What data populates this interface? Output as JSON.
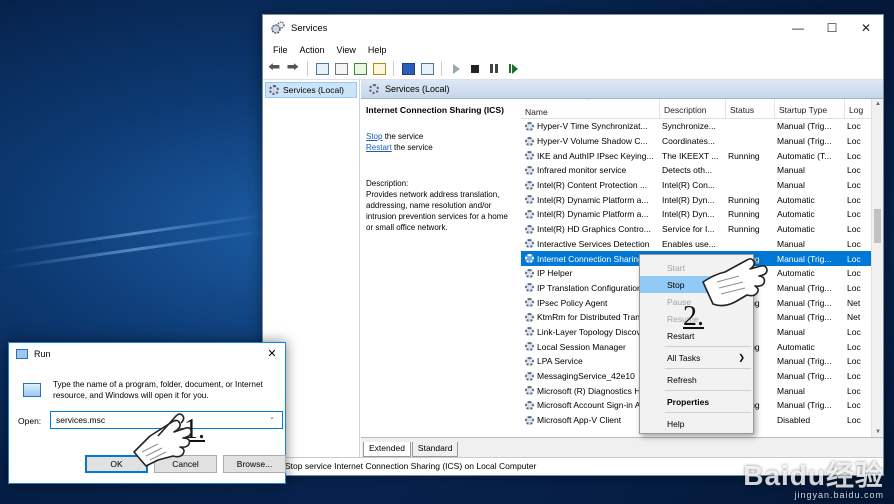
{
  "services_window": {
    "title": "Services",
    "menu": [
      "File",
      "Action",
      "View",
      "Help"
    ],
    "tree_item": "Services (Local)",
    "header": "Services (Local)",
    "detail": {
      "service_name": "Internet Connection Sharing (ICS)",
      "stop_link": "Stop",
      "stop_suffix": " the service",
      "restart_link": "Restart",
      "restart_suffix": " the service",
      "description_label": "Description:",
      "description": "Provides network address translation, addressing, name resolution and/or intrusion prevention services for a home or small office network."
    },
    "columns": [
      "Name",
      "Description",
      "Status",
      "Startup Type",
      "Log"
    ],
    "rows": [
      {
        "name": "Hyper-V Time Synchronizat...",
        "desc": "Synchronize...",
        "status": "",
        "startup": "Manual (Trig...",
        "log": "Loc",
        "selected": false
      },
      {
        "name": "Hyper-V Volume Shadow C...",
        "desc": "Coordinates...",
        "status": "",
        "startup": "Manual (Trig...",
        "log": "Loc",
        "selected": false
      },
      {
        "name": "IKE and AuthIP IPsec Keying...",
        "desc": "The IKEEXT ...",
        "status": "Running",
        "startup": "Automatic (T...",
        "log": "Loc",
        "selected": false
      },
      {
        "name": "Infrared monitor service",
        "desc": "Detects oth...",
        "status": "",
        "startup": "Manual",
        "log": "Loc",
        "selected": false
      },
      {
        "name": "Intel(R) Content Protection ...",
        "desc": "Intel(R) Con...",
        "status": "",
        "startup": "Manual",
        "log": "Loc",
        "selected": false
      },
      {
        "name": "Intel(R) Dynamic Platform a...",
        "desc": "Intel(R) Dyn...",
        "status": "Running",
        "startup": "Automatic",
        "log": "Loc",
        "selected": false
      },
      {
        "name": "Intel(R) Dynamic Platform a...",
        "desc": "Intel(R) Dyn...",
        "status": "Running",
        "startup": "Automatic",
        "log": "Loc",
        "selected": false
      },
      {
        "name": "Intel(R) HD Graphics Contro...",
        "desc": "Service for I...",
        "status": "Running",
        "startup": "Automatic",
        "log": "Loc",
        "selected": false
      },
      {
        "name": "Interactive Services Detection",
        "desc": "Enables use...",
        "status": "",
        "startup": "Manual",
        "log": "Loc",
        "selected": false
      },
      {
        "name": "Internet Connection Sharing (ICS)",
        "desc": "",
        "status": "Running",
        "startup": "Manual (Trig...",
        "log": "Loc",
        "selected": true
      },
      {
        "name": "IP Helper",
        "desc": "",
        "status": "Running",
        "startup": "Automatic",
        "log": "Loc",
        "selected": false
      },
      {
        "name": "IP Translation Configuration Service",
        "desc": "",
        "status": "",
        "startup": "Manual (Trig...",
        "log": "Loc",
        "selected": false
      },
      {
        "name": "IPsec Policy Agent",
        "desc": "",
        "status": "Running",
        "startup": "Manual (Trig...",
        "log": "Net",
        "selected": false
      },
      {
        "name": "KtmRm for Distributed Transaction Coordinator",
        "desc": "",
        "status": "",
        "startup": "Manual (Trig...",
        "log": "Net",
        "selected": false
      },
      {
        "name": "Link-Layer Topology Discovery Mapper",
        "desc": "",
        "status": "",
        "startup": "Manual",
        "log": "Loc",
        "selected": false
      },
      {
        "name": "Local Session Manager",
        "desc": "",
        "status": "Running",
        "startup": "Automatic",
        "log": "Loc",
        "selected": false
      },
      {
        "name": "LPA Service",
        "desc": "",
        "status": "",
        "startup": "Manual (Trig...",
        "log": "Loc",
        "selected": false
      },
      {
        "name": "MessagingService_42e10",
        "desc": "",
        "status": "",
        "startup": "Manual (Trig...",
        "log": "Loc",
        "selected": false
      },
      {
        "name": "Microsoft (R) Diagnostics Hub",
        "desc": "",
        "status": "",
        "startup": "Manual",
        "log": "Loc",
        "selected": false
      },
      {
        "name": "Microsoft Account Sign-in Assistant",
        "desc": "",
        "status": "Running",
        "startup": "Manual (Trig...",
        "log": "Loc",
        "selected": false
      },
      {
        "name": "Microsoft App-V Client",
        "desc": "",
        "status": "",
        "startup": "Disabled",
        "log": "Loc",
        "selected": false
      }
    ],
    "tabs": [
      "Extended",
      "Standard"
    ],
    "status_text": "Stop service Internet Connection Sharing (ICS) on Local Computer"
  },
  "context_menu": {
    "items": [
      {
        "label": "Start",
        "state": "disabled"
      },
      {
        "label": "Stop",
        "state": "hover"
      },
      {
        "label": "Pause",
        "state": "disabled"
      },
      {
        "label": "Resume",
        "state": "disabled"
      },
      {
        "label": "Restart",
        "state": "normal"
      },
      {
        "label": "All Tasks",
        "state": "submenu"
      },
      {
        "label": "Refresh",
        "state": "normal"
      },
      {
        "label": "Properties",
        "state": "bold"
      },
      {
        "label": "Help",
        "state": "normal"
      }
    ]
  },
  "run_dialog": {
    "title": "Run",
    "message": "Type the name of a program, folder, document, or Internet resource, and Windows will open it for you.",
    "open_label": "Open:",
    "input_value": "services.msc",
    "ok_label": "OK",
    "cancel_label": "Cancel",
    "browse_label": "Browse..."
  },
  "annotations": {
    "step1": "1.",
    "step2": "2."
  },
  "watermark": {
    "logo": "Baidu经验",
    "url": "jingyan.baidu.com"
  },
  "colors": {
    "selection": "#0078d7",
    "menu_hover": "#91c9f7",
    "desktop": "#0d3a73"
  }
}
